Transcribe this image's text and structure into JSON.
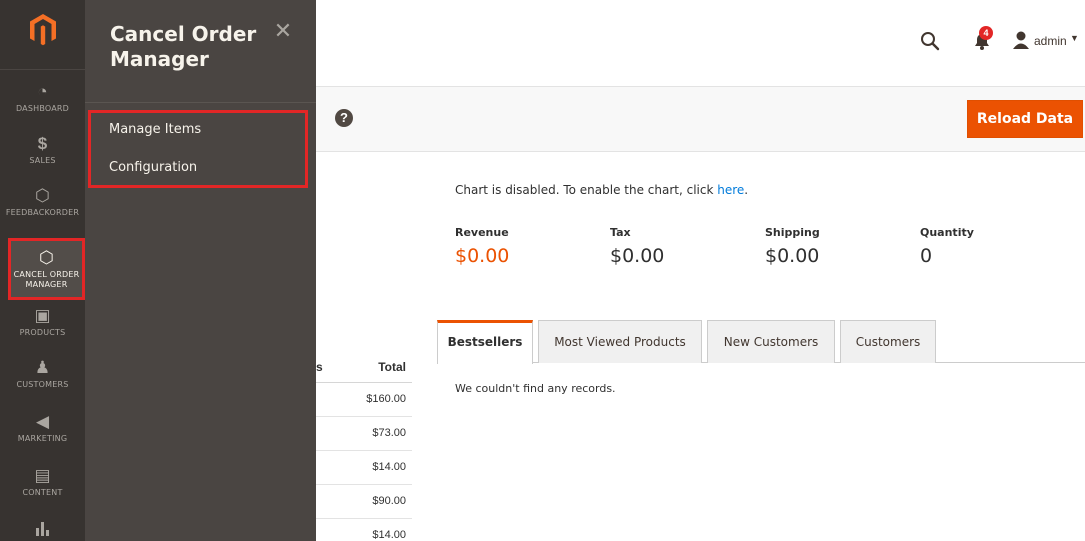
{
  "left_nav": {
    "items": [
      {
        "label": "DASHBOARD",
        "icon": "dashboard-icon"
      },
      {
        "label": "SALES",
        "icon": "dollar-icon"
      },
      {
        "label": "FEEDBACKORDER",
        "icon": "hexagon-icon"
      },
      {
        "label": "CANCEL ORDER MANAGER",
        "icon": "hexagon-icon"
      },
      {
        "label": "PRODUCTS",
        "icon": "box-icon"
      },
      {
        "label": "CUSTOMERS",
        "icon": "person-icon"
      },
      {
        "label": "MARKETING",
        "icon": "megaphone-icon"
      },
      {
        "label": "CONTENT",
        "icon": "layout-icon"
      },
      {
        "label": "",
        "icon": "bar-chart-icon"
      }
    ]
  },
  "flyout": {
    "title": "Cancel Order Manager",
    "links": [
      "Manage Items",
      "Configuration"
    ]
  },
  "header": {
    "notification_count": "4",
    "user_name": "admin"
  },
  "page_actions": {
    "reload_label": "Reload Data"
  },
  "dashboard": {
    "chart_message": "Chart is disabled. To enable the chart, click ",
    "chart_link": "here",
    "chart_message_end": ".",
    "totals": [
      {
        "label": "Revenue",
        "value": "$0.00"
      },
      {
        "label": "Tax",
        "value": "$0.00"
      },
      {
        "label": "Shipping",
        "value": "$0.00"
      },
      {
        "label": "Quantity",
        "value": "0"
      }
    ],
    "partial_table": {
      "col_partial": "s",
      "col_total": "Total",
      "rows": [
        "$160.00",
        "$73.00",
        "$14.00",
        "$90.00",
        "$14.00"
      ]
    },
    "tabs": [
      "Bestsellers",
      "Most Viewed Products",
      "New Customers",
      "Customers"
    ],
    "empty_message": "We couldn't find any records."
  },
  "colors": {
    "accent": "#eb5202",
    "nav_bg": "#373330",
    "flyout_bg": "#4a4542",
    "highlight": "#e22626"
  }
}
